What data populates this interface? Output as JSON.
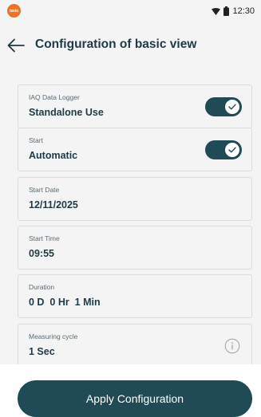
{
  "status_bar": {
    "logo_text": "testo",
    "time": "12:30",
    "icons": [
      "wifi-icon",
      "battery-icon"
    ]
  },
  "header": {
    "title": "Configuration of basic view",
    "back_icon": "arrow-left-icon"
  },
  "settings": [
    {
      "label": "IAQ Data Logger",
      "value": "Standalone Use",
      "control": "toggle",
      "checked": true
    },
    {
      "label": "Start",
      "value": "Automatic",
      "control": "toggle",
      "checked": true
    },
    {
      "label": "Start Date",
      "value": "12/11/2025",
      "control": "none"
    },
    {
      "label": "Start Time",
      "value": "09:55",
      "control": "none"
    },
    {
      "label": "Duration",
      "value": "0 D  0 Hr  1 Min",
      "control": "none"
    },
    {
      "label": "Measuring cycle",
      "value": "1 Sec",
      "control": "info",
      "icon": "info-icon"
    }
  ],
  "footer": {
    "apply_label": "Apply Configuration"
  },
  "colors": {
    "accent": "#1f4a56",
    "logo": "#f36f21",
    "background": "#f4f4f4",
    "card_border": "#dcdcdc"
  }
}
